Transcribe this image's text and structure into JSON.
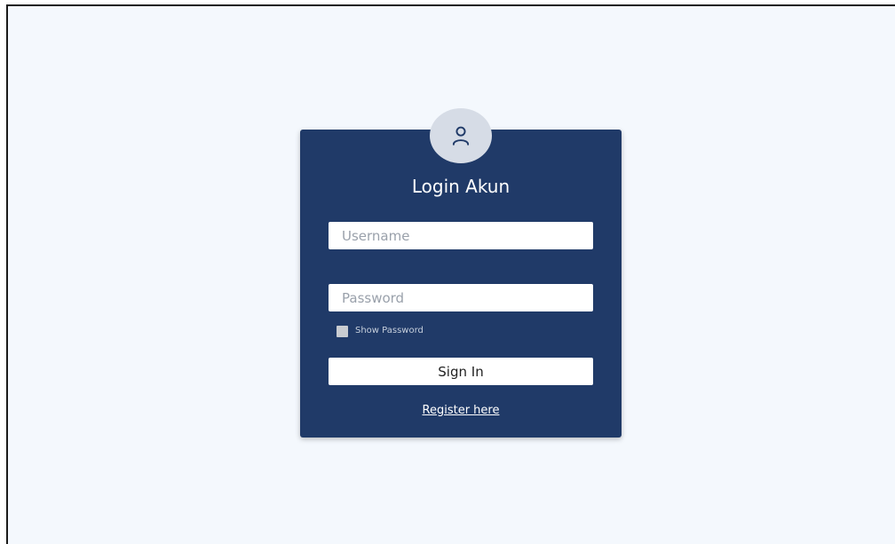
{
  "login_card": {
    "title": "Login Akun",
    "username_placeholder": "Username",
    "password_placeholder": "Password",
    "show_password_label": "Show Password",
    "signin_label": "Sign In",
    "register_label": "Register here"
  },
  "icons": {
    "avatar": "user-icon"
  },
  "colors": {
    "page_background": "#f4f8fd",
    "card_background": "#203a68",
    "avatar_background": "#d6dce6",
    "text_primary": "#ffffff"
  }
}
